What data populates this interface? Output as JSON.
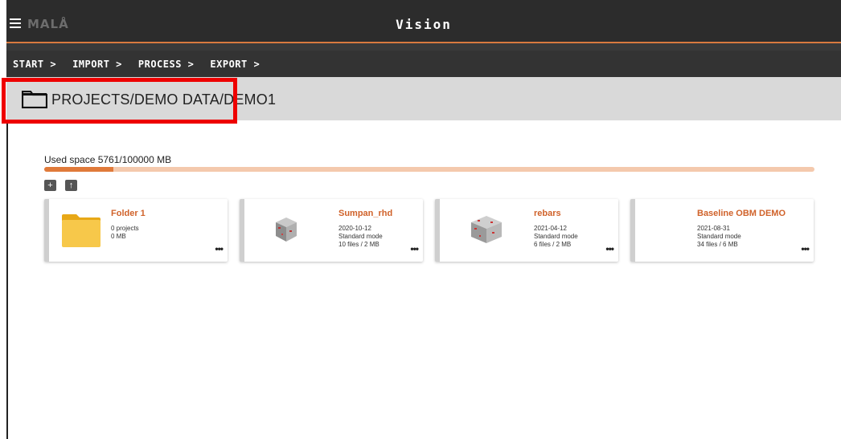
{
  "app": {
    "logo": "MALÅ",
    "title": "Vision"
  },
  "nav": {
    "items": [
      {
        "label": "START >"
      },
      {
        "label": "IMPORT >"
      },
      {
        "label": "PROCESS >"
      },
      {
        "label": "EXPORT >"
      }
    ]
  },
  "path": {
    "text": "PROJECTS/DEMO DATA/DEMO1",
    "icon": "folder-outline-icon"
  },
  "usage": {
    "label": "Used space 5761/100000 MB",
    "used": 5761,
    "total": 100000,
    "fill_color": "#e07a3a",
    "track_color": "#f4c9ad"
  },
  "tools": {
    "new_folder_icon": "+",
    "upload_icon": "↑"
  },
  "cards": [
    {
      "title": "Folder 1",
      "line1": "0 projects",
      "line2": "0 MB",
      "line3": "",
      "more": "•••"
    },
    {
      "title": "Sumpan_rhd",
      "line1": "2020-10-12",
      "line2": "Standard mode",
      "line3": "10 files / 2 MB",
      "more": "•••"
    },
    {
      "title": "rebars",
      "line1": "2021-04-12",
      "line2": "Standard mode",
      "line3": "6 files / 2 MB",
      "more": "•••"
    },
    {
      "title": "Baseline OBM DEMO",
      "line1": "2021-08-31",
      "line2": "Standard mode",
      "line3": "34 files / 6 MB",
      "more": "•••"
    }
  ],
  "colors": {
    "accent": "#d97a3f",
    "card_title": "#d0622a",
    "highlight": "#e00000"
  }
}
